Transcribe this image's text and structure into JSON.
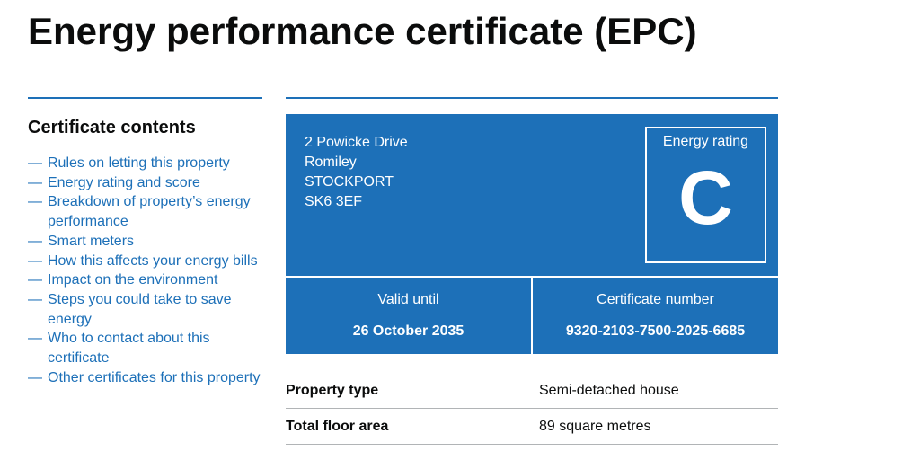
{
  "page": {
    "title": "Energy performance certificate (EPC)"
  },
  "sidebar": {
    "heading": "Certificate contents",
    "items": [
      {
        "label": "Rules on letting this property"
      },
      {
        "label": "Energy rating and score"
      },
      {
        "label": "Breakdown of property’s energy performance"
      },
      {
        "label": "Smart meters"
      },
      {
        "label": "How this affects your energy bills"
      },
      {
        "label": "Impact on the environment"
      },
      {
        "label": "Steps you could take to save energy"
      },
      {
        "label": "Who to contact about this certificate"
      },
      {
        "label": "Other certificates for this property"
      }
    ]
  },
  "certificate": {
    "address": [
      "2 Powicke Drive",
      "Romiley",
      "STOCKPORT",
      "SK6 3EF"
    ],
    "rating_label": "Energy rating",
    "rating": "C",
    "valid_until_label": "Valid until",
    "valid_until": "26 October 2035",
    "certificate_number_label": "Certificate number",
    "certificate_number": "9320-2103-7500-2025-6685"
  },
  "summary": [
    {
      "key": "Property type",
      "value": "Semi-detached house"
    },
    {
      "key": "Total floor area",
      "value": "89 square metres"
    }
  ],
  "colors": {
    "brand_blue": "#1d70b8",
    "text": "#0b0c0c",
    "divider": "#b1b4b6"
  }
}
